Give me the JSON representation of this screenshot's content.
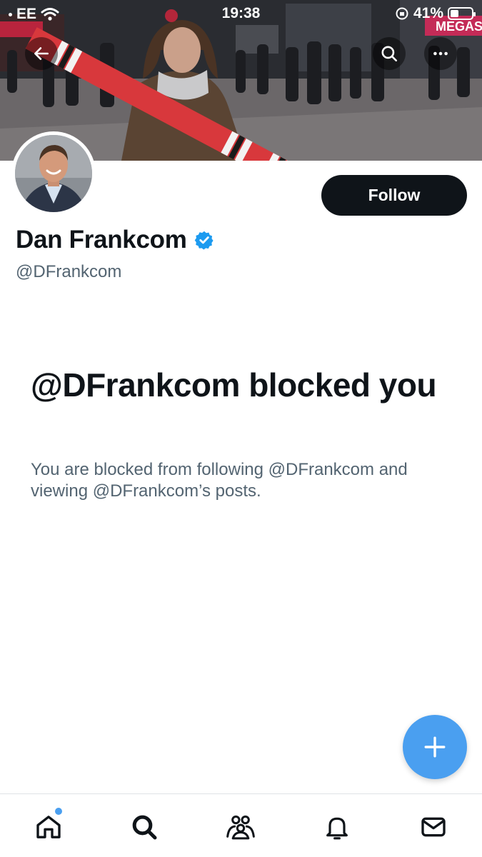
{
  "status_bar": {
    "carrier": "EE",
    "time": "19:38",
    "battery_text": "41%",
    "battery_level": 0.41
  },
  "banner": {
    "sign_text": "MEGAS",
    "scarf_colors": [
      "#d8383c",
      "#f2f2f2",
      "#1b1b1b"
    ]
  },
  "header": {
    "back_icon": "arrow-left-icon",
    "search_icon": "search-icon",
    "more_icon": "more-horizontal-icon"
  },
  "profile": {
    "display_name": "Dan Frankcom",
    "handle": "@DFrankcom",
    "verified_icon": "verified-badge-icon",
    "verified_color": "#1d9bf0",
    "follow_label": "Follow"
  },
  "blocked": {
    "title": "@DFrankcom blocked you",
    "description": "You are blocked from following @DFrankcom and viewing @DFrankcom’s posts."
  },
  "fab": {
    "icon": "plus-icon",
    "color": "#4a9ff0"
  },
  "tabbar": {
    "items": [
      {
        "name": "home",
        "icon": "home-icon",
        "has_dot": true
      },
      {
        "name": "search",
        "icon": "search-icon",
        "has_dot": false
      },
      {
        "name": "communities",
        "icon": "communities-icon",
        "has_dot": false
      },
      {
        "name": "notifications",
        "icon": "bell-icon",
        "has_dot": false
      },
      {
        "name": "messages",
        "icon": "mail-icon",
        "has_dot": false
      }
    ],
    "dot_color": "#4a9ff0"
  }
}
